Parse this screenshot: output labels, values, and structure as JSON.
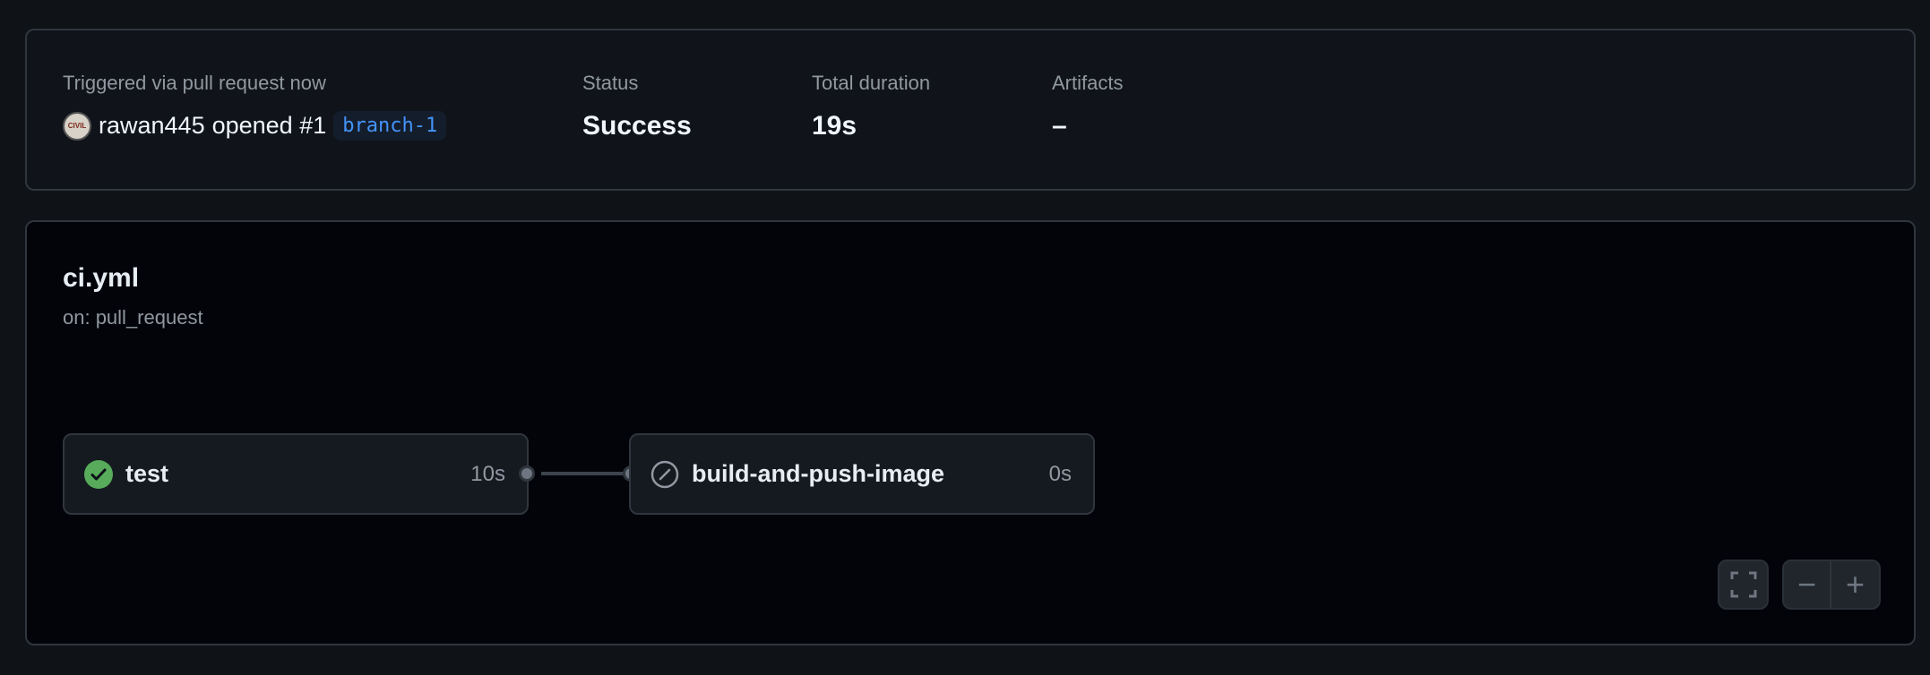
{
  "summary": {
    "trigger_label": "Triggered via pull request now",
    "actor": "rawan445",
    "action": "opened #1",
    "branch": "branch-1",
    "status_label": "Status",
    "status_value": "Success",
    "duration_label": "Total duration",
    "duration_value": "19s",
    "artifacts_label": "Artifacts",
    "artifacts_value": "–"
  },
  "workflow": {
    "title": "ci.yml",
    "trigger": "on: pull_request",
    "jobs": [
      {
        "name": "test",
        "duration": "10s",
        "status": "success",
        "icon": "check-circle-icon"
      },
      {
        "name": "build-and-push-image",
        "duration": "0s",
        "status": "skipped",
        "icon": "skip-icon"
      }
    ]
  },
  "controls": {
    "fullscreen_icon": "fullscreen-icon",
    "zoom_out": "−",
    "zoom_in": "+"
  },
  "colors": {
    "success": "#57ab5a",
    "branch": "#4493f8"
  }
}
